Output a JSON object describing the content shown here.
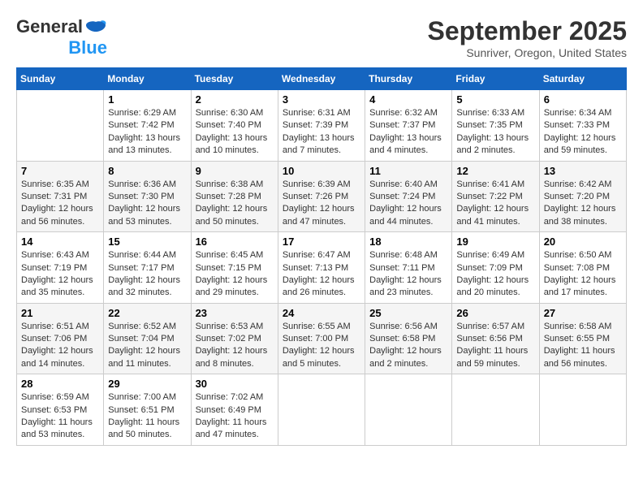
{
  "header": {
    "logo_general": "General",
    "logo_blue": "Blue",
    "main_title": "September 2025",
    "subtitle": "Sunriver, Oregon, United States"
  },
  "days_of_week": [
    "Sunday",
    "Monday",
    "Tuesday",
    "Wednesday",
    "Thursday",
    "Friday",
    "Saturday"
  ],
  "weeks": [
    [
      {
        "num": "",
        "info": ""
      },
      {
        "num": "1",
        "info": "Sunrise: 6:29 AM\nSunset: 7:42 PM\nDaylight: 13 hours and 13 minutes."
      },
      {
        "num": "2",
        "info": "Sunrise: 6:30 AM\nSunset: 7:40 PM\nDaylight: 13 hours and 10 minutes."
      },
      {
        "num": "3",
        "info": "Sunrise: 6:31 AM\nSunset: 7:39 PM\nDaylight: 13 hours and 7 minutes."
      },
      {
        "num": "4",
        "info": "Sunrise: 6:32 AM\nSunset: 7:37 PM\nDaylight: 13 hours and 4 minutes."
      },
      {
        "num": "5",
        "info": "Sunrise: 6:33 AM\nSunset: 7:35 PM\nDaylight: 13 hours and 2 minutes."
      },
      {
        "num": "6",
        "info": "Sunrise: 6:34 AM\nSunset: 7:33 PM\nDaylight: 12 hours and 59 minutes."
      }
    ],
    [
      {
        "num": "7",
        "info": "Sunrise: 6:35 AM\nSunset: 7:31 PM\nDaylight: 12 hours and 56 minutes."
      },
      {
        "num": "8",
        "info": "Sunrise: 6:36 AM\nSunset: 7:30 PM\nDaylight: 12 hours and 53 minutes."
      },
      {
        "num": "9",
        "info": "Sunrise: 6:38 AM\nSunset: 7:28 PM\nDaylight: 12 hours and 50 minutes."
      },
      {
        "num": "10",
        "info": "Sunrise: 6:39 AM\nSunset: 7:26 PM\nDaylight: 12 hours and 47 minutes."
      },
      {
        "num": "11",
        "info": "Sunrise: 6:40 AM\nSunset: 7:24 PM\nDaylight: 12 hours and 44 minutes."
      },
      {
        "num": "12",
        "info": "Sunrise: 6:41 AM\nSunset: 7:22 PM\nDaylight: 12 hours and 41 minutes."
      },
      {
        "num": "13",
        "info": "Sunrise: 6:42 AM\nSunset: 7:20 PM\nDaylight: 12 hours and 38 minutes."
      }
    ],
    [
      {
        "num": "14",
        "info": "Sunrise: 6:43 AM\nSunset: 7:19 PM\nDaylight: 12 hours and 35 minutes."
      },
      {
        "num": "15",
        "info": "Sunrise: 6:44 AM\nSunset: 7:17 PM\nDaylight: 12 hours and 32 minutes."
      },
      {
        "num": "16",
        "info": "Sunrise: 6:45 AM\nSunset: 7:15 PM\nDaylight: 12 hours and 29 minutes."
      },
      {
        "num": "17",
        "info": "Sunrise: 6:47 AM\nSunset: 7:13 PM\nDaylight: 12 hours and 26 minutes."
      },
      {
        "num": "18",
        "info": "Sunrise: 6:48 AM\nSunset: 7:11 PM\nDaylight: 12 hours and 23 minutes."
      },
      {
        "num": "19",
        "info": "Sunrise: 6:49 AM\nSunset: 7:09 PM\nDaylight: 12 hours and 20 minutes."
      },
      {
        "num": "20",
        "info": "Sunrise: 6:50 AM\nSunset: 7:08 PM\nDaylight: 12 hours and 17 minutes."
      }
    ],
    [
      {
        "num": "21",
        "info": "Sunrise: 6:51 AM\nSunset: 7:06 PM\nDaylight: 12 hours and 14 minutes."
      },
      {
        "num": "22",
        "info": "Sunrise: 6:52 AM\nSunset: 7:04 PM\nDaylight: 12 hours and 11 minutes."
      },
      {
        "num": "23",
        "info": "Sunrise: 6:53 AM\nSunset: 7:02 PM\nDaylight: 12 hours and 8 minutes."
      },
      {
        "num": "24",
        "info": "Sunrise: 6:55 AM\nSunset: 7:00 PM\nDaylight: 12 hours and 5 minutes."
      },
      {
        "num": "25",
        "info": "Sunrise: 6:56 AM\nSunset: 6:58 PM\nDaylight: 12 hours and 2 minutes."
      },
      {
        "num": "26",
        "info": "Sunrise: 6:57 AM\nSunset: 6:56 PM\nDaylight: 11 hours and 59 minutes."
      },
      {
        "num": "27",
        "info": "Sunrise: 6:58 AM\nSunset: 6:55 PM\nDaylight: 11 hours and 56 minutes."
      }
    ],
    [
      {
        "num": "28",
        "info": "Sunrise: 6:59 AM\nSunset: 6:53 PM\nDaylight: 11 hours and 53 minutes."
      },
      {
        "num": "29",
        "info": "Sunrise: 7:00 AM\nSunset: 6:51 PM\nDaylight: 11 hours and 50 minutes."
      },
      {
        "num": "30",
        "info": "Sunrise: 7:02 AM\nSunset: 6:49 PM\nDaylight: 11 hours and 47 minutes."
      },
      {
        "num": "",
        "info": ""
      },
      {
        "num": "",
        "info": ""
      },
      {
        "num": "",
        "info": ""
      },
      {
        "num": "",
        "info": ""
      }
    ]
  ]
}
